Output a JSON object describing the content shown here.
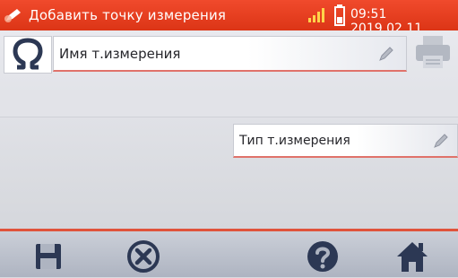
{
  "status_bar": {
    "title": "Добавить точку измерения",
    "clock": "09:51 2019.02.11",
    "accent_color": "#e8401f",
    "icons": [
      "back-pencil-icon",
      "signal-icon",
      "battery-icon"
    ]
  },
  "form": {
    "name_label": "Имя т.измерения",
    "type_label": "Тип т.измерения",
    "icons": [
      "omega-icon",
      "pencil-icon",
      "printer-icon"
    ]
  },
  "toolbar": {
    "icons": [
      "save-icon",
      "cancel-icon",
      "help-icon",
      "home-icon"
    ],
    "icon_color": "#2c3854"
  }
}
